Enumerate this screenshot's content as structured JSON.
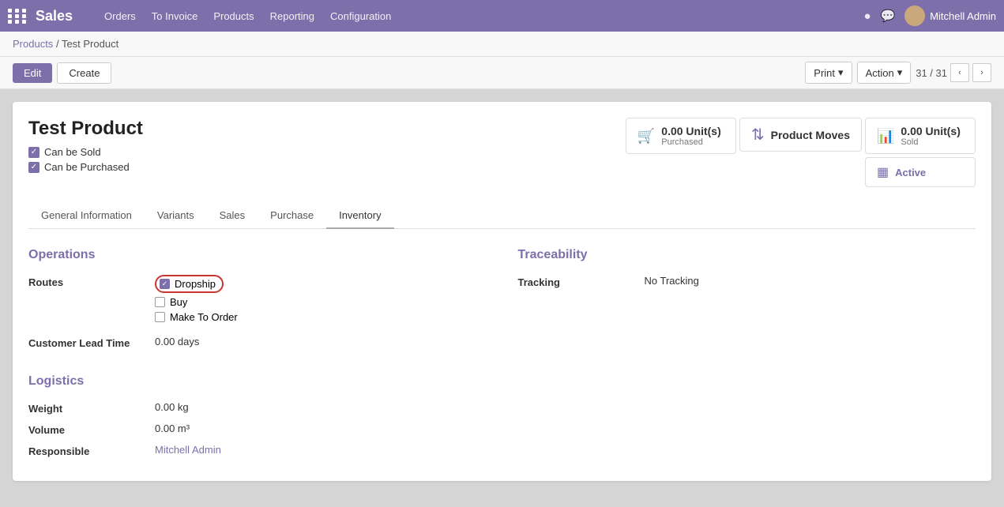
{
  "app": {
    "name": "Sales",
    "logo_dots": 9
  },
  "topnav": {
    "menu": [
      {
        "label": "Orders",
        "id": "orders"
      },
      {
        "label": "To Invoice",
        "id": "to-invoice"
      },
      {
        "label": "Products",
        "id": "products"
      },
      {
        "label": "Reporting",
        "id": "reporting"
      },
      {
        "label": "Configuration",
        "id": "configuration"
      }
    ],
    "user": "Mitchell Admin"
  },
  "breadcrumb": {
    "parent": "Products",
    "separator": "/",
    "current": "Test Product"
  },
  "toolbar": {
    "edit_label": "Edit",
    "create_label": "Create",
    "print_label": "Print",
    "action_label": "Action",
    "pager": "31 / 31"
  },
  "product": {
    "name": "Test Product",
    "can_be_sold": true,
    "can_be_sold_label": "Can be Sold",
    "can_be_purchased": true,
    "can_be_purchased_label": "Can be Purchased"
  },
  "stats": {
    "purchased": {
      "value": "0.00 Unit(s)",
      "label": "Purchased"
    },
    "product_moves": {
      "label": "Product Moves"
    },
    "sold": {
      "value": "0.00 Unit(s)",
      "label": "Sold"
    },
    "active": {
      "label": "Active"
    }
  },
  "tabs": [
    {
      "label": "General Information",
      "id": "general-information",
      "active": false
    },
    {
      "label": "Variants",
      "id": "variants",
      "active": false
    },
    {
      "label": "Sales",
      "id": "sales",
      "active": false
    },
    {
      "label": "Purchase",
      "id": "purchase",
      "active": false
    },
    {
      "label": "Inventory",
      "id": "inventory",
      "active": true
    }
  ],
  "inventory_tab": {
    "operations": {
      "title": "Operations",
      "routes_label": "Routes",
      "routes": [
        {
          "label": "Dropship",
          "checked": true,
          "highlight": true
        },
        {
          "label": "Buy",
          "checked": false,
          "highlight": false
        },
        {
          "label": "Make To Order",
          "checked": false,
          "highlight": false
        }
      ],
      "customer_lead_time_label": "Customer Lead Time",
      "customer_lead_time_value": "0.00 days"
    },
    "traceability": {
      "title": "Traceability",
      "tracking_label": "Tracking",
      "tracking_value": "No Tracking"
    },
    "logistics": {
      "title": "Logistics",
      "weight_label": "Weight",
      "weight_value": "0.00 kg",
      "volume_label": "Volume",
      "volume_value": "0.00 m³",
      "responsible_label": "Responsible",
      "responsible_value": "Mitchell Admin"
    }
  }
}
